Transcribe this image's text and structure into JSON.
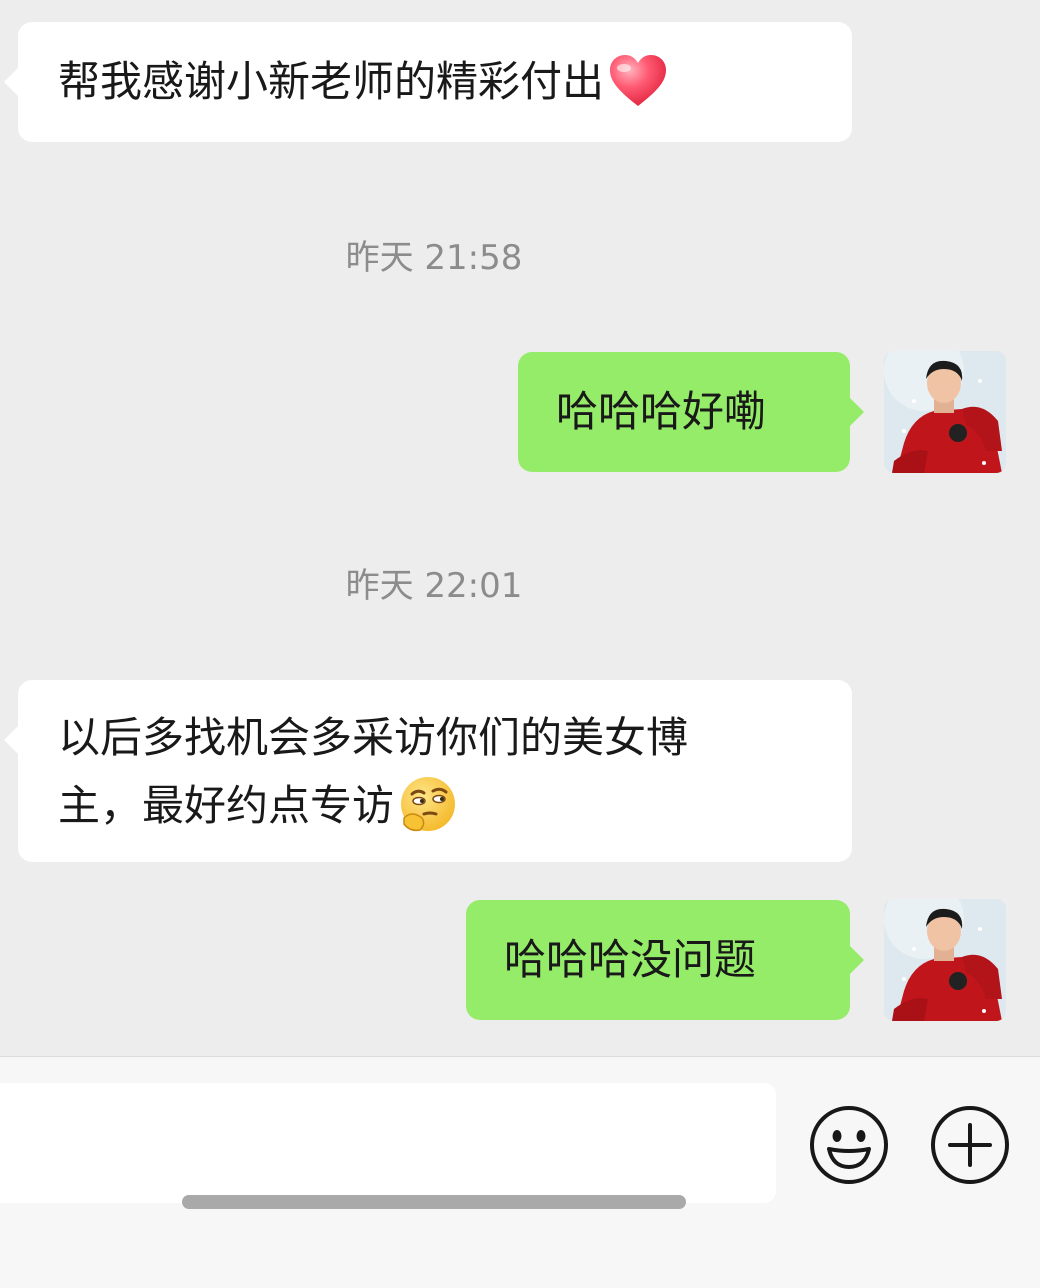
{
  "messages": [
    {
      "direction": "in",
      "text": "帮我感谢小新老师的精彩付出",
      "emoji": "red-heart"
    },
    {
      "timestamp": "昨天 21:58"
    },
    {
      "direction": "out",
      "text": "哈哈哈好嘞"
    },
    {
      "timestamp": "昨天 22:01"
    },
    {
      "direction": "in",
      "line1": "以后多找机会多采访你们的美女博",
      "line2": "主，最好约点专访",
      "emoji": "thinking-face"
    },
    {
      "direction": "out",
      "text": "哈哈哈没问题"
    }
  ],
  "input": {
    "value": "",
    "placeholder": ""
  },
  "icons": {
    "emoji_button": "smiley-face-icon",
    "more_button": "plus-circle-icon"
  },
  "colors": {
    "background": "#ededed",
    "incoming_bubble": "#ffffff",
    "outgoing_bubble": "#95ec69",
    "timestamp_text": "#8c8c8c"
  }
}
